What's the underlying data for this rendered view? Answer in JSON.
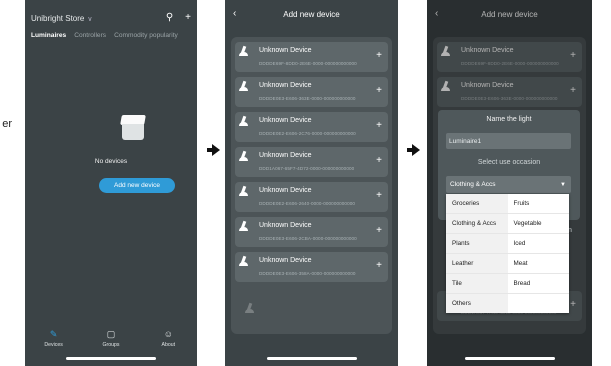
{
  "side_label": "er",
  "phone1": {
    "store_name": "Unibright Store",
    "tabs": [
      "Luminaires",
      "Controllers",
      "Commodity popularity"
    ],
    "empty_text": "No devices",
    "add_button": "Add new device",
    "nav": [
      "Devices",
      "Groups",
      "About"
    ]
  },
  "phone2": {
    "title": "Add new device",
    "devices": [
      {
        "name": "Unknown Device",
        "uuid": "DDDDE69F-8DD0-2E6E-0000-000000000000"
      },
      {
        "name": "Unknown Device",
        "uuid": "DDDDE0E3-E606-363E-0000-000000000000"
      },
      {
        "name": "Unknown Device",
        "uuid": "DDDDE0E2-E606-2C76-0000-000000000000"
      },
      {
        "name": "Unknown Device",
        "uuid": "DDD1A067-65F7-4D72-0000-000000000000"
      },
      {
        "name": "Unknown Device",
        "uuid": "DDDDE0E2-E606-2640-0000-000000000000"
      },
      {
        "name": "Unknown Device",
        "uuid": "DDDDE0E3-E606-2CBA-0000-000000000000"
      },
      {
        "name": "Unknown Device",
        "uuid": "DDDDE0E3-E606-358A-0000-000000000000"
      }
    ]
  },
  "phone3": {
    "title": "Add new device",
    "devices": [
      {
        "name": "Unknown Device",
        "uuid": "DDDDE69F-8DD0-2E6E-0000-000000000000"
      },
      {
        "name": "Unknown Device",
        "uuid": "DDDDE0E3-E606-363E-0000-000000000000"
      }
    ],
    "bottom_uuid": "DDD1A067-7A46-4D12-0000-000000000000",
    "dialog": {
      "title": "Name the light",
      "name_value": "Luminaire1",
      "occasion_label": "Select use occasion",
      "selected": "Clothing & Accs"
    },
    "options": [
      [
        "Groceries",
        "Fruits"
      ],
      [
        "Clothing & Accs",
        "Vegetable"
      ],
      [
        "Plants",
        "Iced"
      ],
      [
        "Leather",
        "Meat"
      ],
      [
        "Tile",
        "Bread"
      ],
      [
        "Others",
        ""
      ]
    ]
  }
}
